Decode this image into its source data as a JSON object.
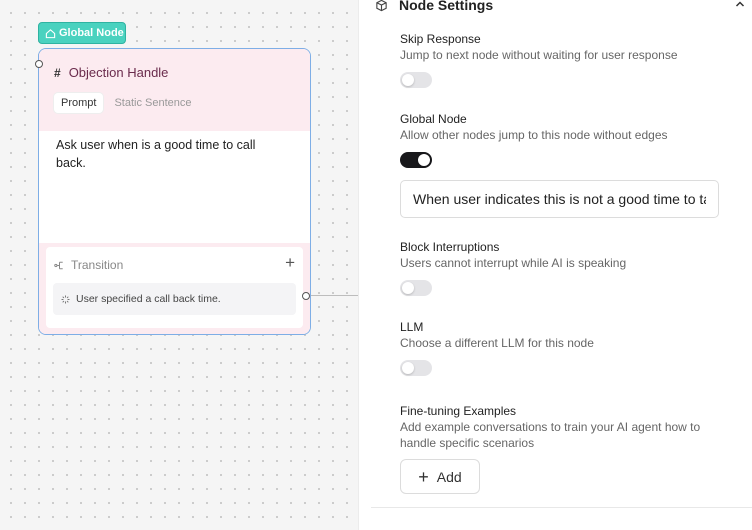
{
  "canvas": {
    "badge_label": "Global Node",
    "node": {
      "title": "Objection Handle",
      "hash": "#",
      "tabs": [
        {
          "label": "Prompt",
          "active": true
        },
        {
          "label": "Static Sentence",
          "active": false
        }
      ],
      "prompt_text": "Ask user when is a good time to call back.",
      "transition": {
        "label": "Transition",
        "add_symbol": "+",
        "items": [
          {
            "label": "User specified a call back time."
          }
        ]
      }
    }
  },
  "panel": {
    "title": "Node Settings",
    "settings": [
      {
        "label": "Skip Response",
        "desc": "Jump to next node without waiting for user response",
        "enabled": false
      },
      {
        "label": "Global Node",
        "desc": "Allow other nodes jump to this node without edges",
        "enabled": true,
        "condition_value": "When user indicates this is not a good time to talk"
      },
      {
        "label": "Block Interruptions",
        "desc": "Users cannot interrupt while AI is speaking",
        "enabled": false
      },
      {
        "label": "LLM",
        "desc": "Choose a different LLM for this node",
        "enabled": false
      },
      {
        "label": "Fine-tuning Examples",
        "desc": "Add example conversations to train your AI agent how to handle specific scenarios"
      }
    ],
    "add_button": {
      "symbol": "+",
      "label": "Add"
    }
  },
  "colors": {
    "badge": "#4ad2bf",
    "node_border": "#7eaee6",
    "node_header_bg": "#fcebf0",
    "toggle_on": "#18181b",
    "toggle_off": "#e4e4e7"
  },
  "icons": [
    "home-icon",
    "hash-icon",
    "transition-icon",
    "plus-icon",
    "loader-icon",
    "cube-icon",
    "chevron-up-icon"
  ]
}
